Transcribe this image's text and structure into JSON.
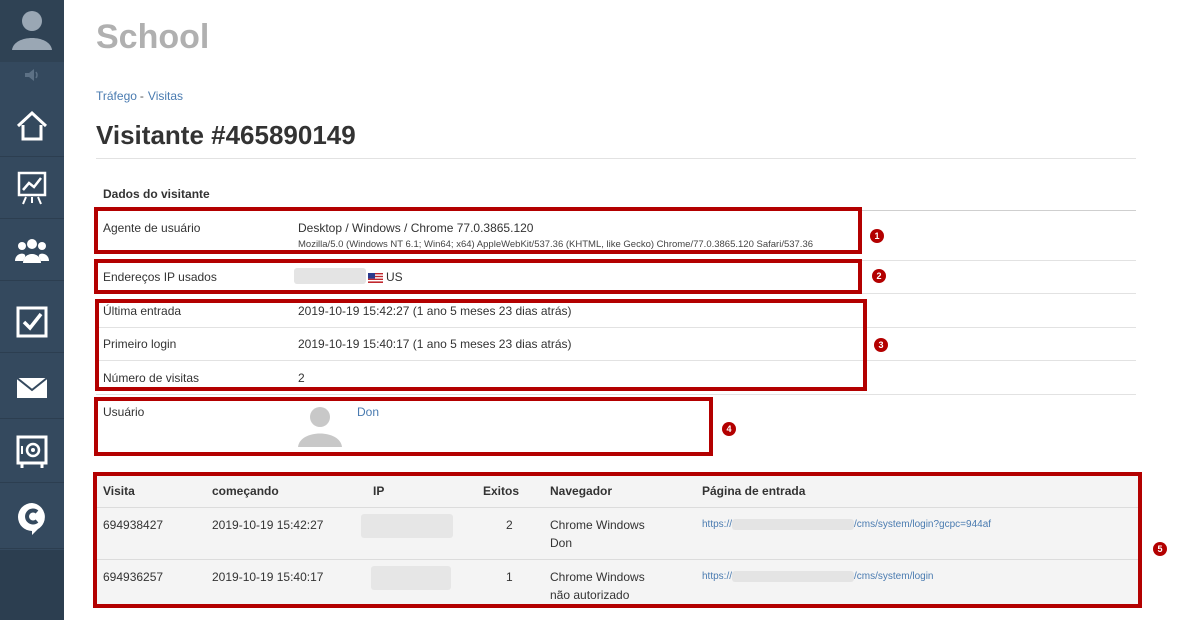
{
  "sidebar": {
    "items": [
      {
        "icon": "home-icon"
      },
      {
        "icon": "chart-icon"
      },
      {
        "icon": "users-icon"
      },
      {
        "icon": "tasks-icon"
      },
      {
        "icon": "mail-icon"
      },
      {
        "icon": "safe-icon"
      },
      {
        "icon": "brand-c-icon"
      }
    ]
  },
  "header": {
    "school": "School"
  },
  "breadcrumb": {
    "item1": "Tráfego",
    "sep": "-",
    "item2": "Visitas"
  },
  "page": {
    "title": "Visitante #465890149"
  },
  "section": {
    "title": "Dados do visitante"
  },
  "visitor": {
    "agent_label": "Agente de usuário",
    "agent_value": "Desktop / Windows / Chrome 77.0.3865.120",
    "agent_ua": "Mozilla/5.0 (Windows NT 6.1; Win64; x64) AppleWebKit/537.36 (KHTML, like Gecko) Chrome/77.0.3865.120 Safari/537.36",
    "ip_label": "Endereços IP usados",
    "ip_country": "US",
    "last_label": "Última entrada",
    "last_value": "2019-10-19 15:42:27 (1 ano 5 meses 23 dias atrás)",
    "first_label": "Primeiro login",
    "first_value": "2019-10-19 15:40:17 (1 ano 5 meses 23 dias atrás)",
    "visits_label": "Número de visitas",
    "visits_value": "2",
    "user_label": "Usuário",
    "user_name": "Don"
  },
  "annotations": [
    "1",
    "2",
    "3",
    "4",
    "5"
  ],
  "table": {
    "headers": [
      "Visita",
      "começando",
      "IP",
      "Exitos",
      "Navegador",
      "Página de entrada"
    ],
    "rows": [
      {
        "visit": "694938427",
        "start": "2019-10-19 15:42:27",
        "exits": "2",
        "browser": "Chrome Windows",
        "user": "Don",
        "url_prefix": "https://",
        "url_suffix": "/cms/system/login?gcpc=944af"
      },
      {
        "visit": "694936257",
        "start": "2019-10-19 15:40:17",
        "exits": "1",
        "browser": "Chrome Windows",
        "user": "não autorizado",
        "url_prefix": "https://",
        "url_suffix": "/cms/system/login"
      }
    ]
  },
  "colors": {
    "sidebar": "#34495e",
    "accent_red": "#b30000",
    "link": "#4a7bb0"
  }
}
